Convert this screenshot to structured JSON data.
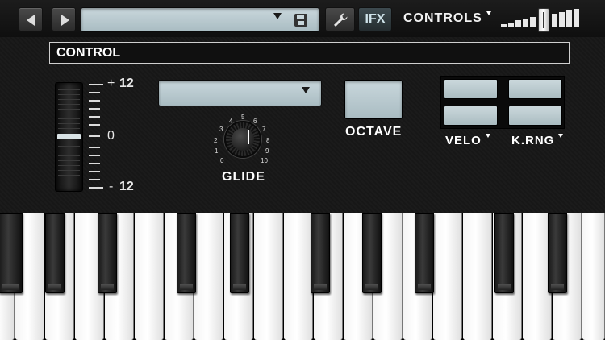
{
  "toolbar": {
    "prev_icon": "triangle-left-icon",
    "next_icon": "triangle-right-icon",
    "preset_value": "",
    "save_icon": "floppy-disk-icon",
    "settings_icon": "wrench-icon",
    "ifx_label": "IFX",
    "controls_label": "CONTROLS",
    "volume_level": 0.55
  },
  "panel": {
    "section_title": "CONTROL",
    "pitch": {
      "top_sign": "+",
      "top_value": "12",
      "mid_value": "0",
      "bottom_sign": "-",
      "bottom_value": "12"
    },
    "glide": {
      "dropdown_value": "",
      "label": "GLIDE",
      "knob_value": 5,
      "knob_scale": [
        "0",
        "1",
        "2",
        "3",
        "4",
        "5",
        "6",
        "7",
        "8",
        "9",
        "10"
      ]
    },
    "octave_label": "OCTAVE",
    "velo_label": "VELO",
    "krng_label": "K.RNG"
  },
  "colors": {
    "lcd": "#b9cbd0",
    "background": "#141414",
    "accent_ifx": "#cfe3ea"
  }
}
